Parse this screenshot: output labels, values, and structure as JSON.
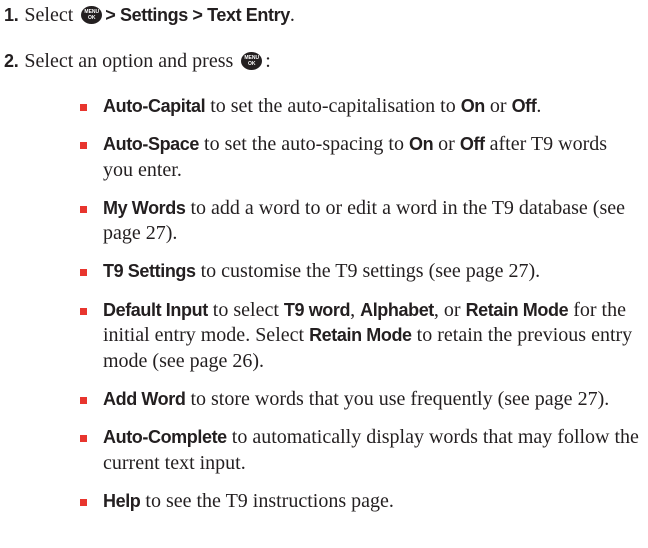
{
  "step1": {
    "number": "1.",
    "select_text": "Select",
    "menu_key": {
      "icon": "menu-ok-key-icon",
      "top": "MENU",
      "bottom": "OK"
    },
    "path": "> Settings > Text Entry",
    "end": "."
  },
  "step2": {
    "number": "2.",
    "text": "Select an option and press",
    "menu_key": {
      "icon": "menu-ok-key-icon",
      "top": "MENU",
      "bottom": "OK"
    },
    "end": ":"
  },
  "bullet_color": "#e8352e",
  "options": [
    {
      "segments": [
        {
          "text": "Auto-Capital",
          "bold": true
        },
        {
          "text": " to set the auto-capitalisation to ",
          "bold": false
        },
        {
          "text": "On",
          "bold": true
        },
        {
          "text": " or ",
          "bold": false
        },
        {
          "text": "Off",
          "bold": true
        },
        {
          "text": ".",
          "bold": false
        }
      ]
    },
    {
      "segments": [
        {
          "text": "Auto-Space",
          "bold": true
        },
        {
          "text": " to set the auto-spacing to ",
          "bold": false
        },
        {
          "text": "On",
          "bold": true
        },
        {
          "text": " or ",
          "bold": false
        },
        {
          "text": "Off",
          "bold": true
        },
        {
          "text": " after T9 words you enter.",
          "bold": false
        }
      ]
    },
    {
      "segments": [
        {
          "text": "My Words",
          "bold": true
        },
        {
          "text": " to add a word to or edit a word in the T9 database (see page 27).",
          "bold": false
        }
      ]
    },
    {
      "segments": [
        {
          "text": "T9 Settings",
          "bold": true
        },
        {
          "text": " to customise the T9 settings (see page 27).",
          "bold": false
        }
      ]
    },
    {
      "segments": [
        {
          "text": "Default Input",
          "bold": true
        },
        {
          "text": " to select ",
          "bold": false
        },
        {
          "text": "T9 word",
          "bold": true
        },
        {
          "text": ", ",
          "bold": false
        },
        {
          "text": "Alphabet",
          "bold": true
        },
        {
          "text": ", or ",
          "bold": false
        },
        {
          "text": "Retain Mode",
          "bold": true
        },
        {
          "text": " for the initial entry mode. Select ",
          "bold": false
        },
        {
          "text": "Retain Mode",
          "bold": true
        },
        {
          "text": " to retain the previous entry mode (see page 26).",
          "bold": false
        }
      ]
    },
    {
      "segments": [
        {
          "text": "Add Word",
          "bold": true
        },
        {
          "text": " to store words that you use frequently (see page 27).",
          "bold": false
        }
      ]
    },
    {
      "segments": [
        {
          "text": "Auto-Complete",
          "bold": true
        },
        {
          "text": " to automatically display words that may follow the current text input.",
          "bold": false
        }
      ]
    },
    {
      "segments": [
        {
          "text": "Help",
          "bold": true
        },
        {
          "text": " to see the T9 instructions page.",
          "bold": false
        }
      ]
    }
  ]
}
